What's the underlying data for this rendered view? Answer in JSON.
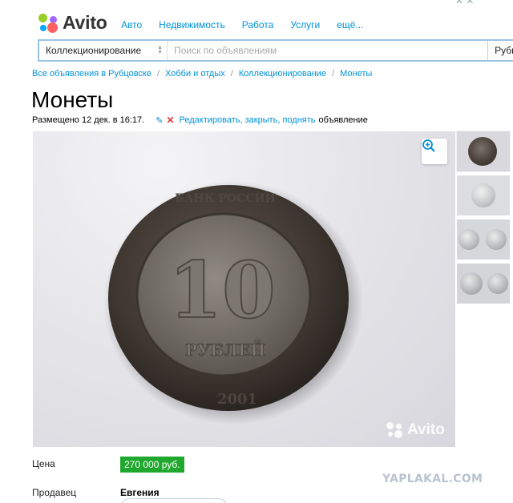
{
  "header": {
    "logo_text": "Avito",
    "nav": [
      "Авто",
      "Недвижимость",
      "Работа",
      "Услуги",
      "ещё..."
    ]
  },
  "search": {
    "category": "Коллекционирование",
    "placeholder": "Поиск по объявлениям",
    "city": "Рубц"
  },
  "breadcrumbs": [
    "Все объявления в Рубцовске",
    "Хобби и отдых",
    "Коллекционирование",
    "Монеты"
  ],
  "listing": {
    "title": "Монеты",
    "posted": "Размещено 12 дек. в 16:17.",
    "edit_link": "Редактировать, закрыть, поднять",
    "edit_suffix": "объявление"
  },
  "gallery": {
    "watermark": "Avito",
    "coin_text": {
      "denomination": "10",
      "rubles": "РУБЛЕЙ",
      "year": "2001",
      "rim": "БАНК РОССИИ"
    }
  },
  "details": {
    "price_label": "Цена",
    "price": "270 000 руб.",
    "seller_label": "Продавец",
    "seller_name": "Евгения"
  },
  "site_watermark": "YAPLAKAL.COM",
  "icons": [
    "zoom-in-icon",
    "pencil-icon",
    "cross-icon",
    "select-arrows-icon"
  ],
  "colors": {
    "link": "#0091d9",
    "price_bg": "#20a82e",
    "delete": "#e4343a"
  }
}
